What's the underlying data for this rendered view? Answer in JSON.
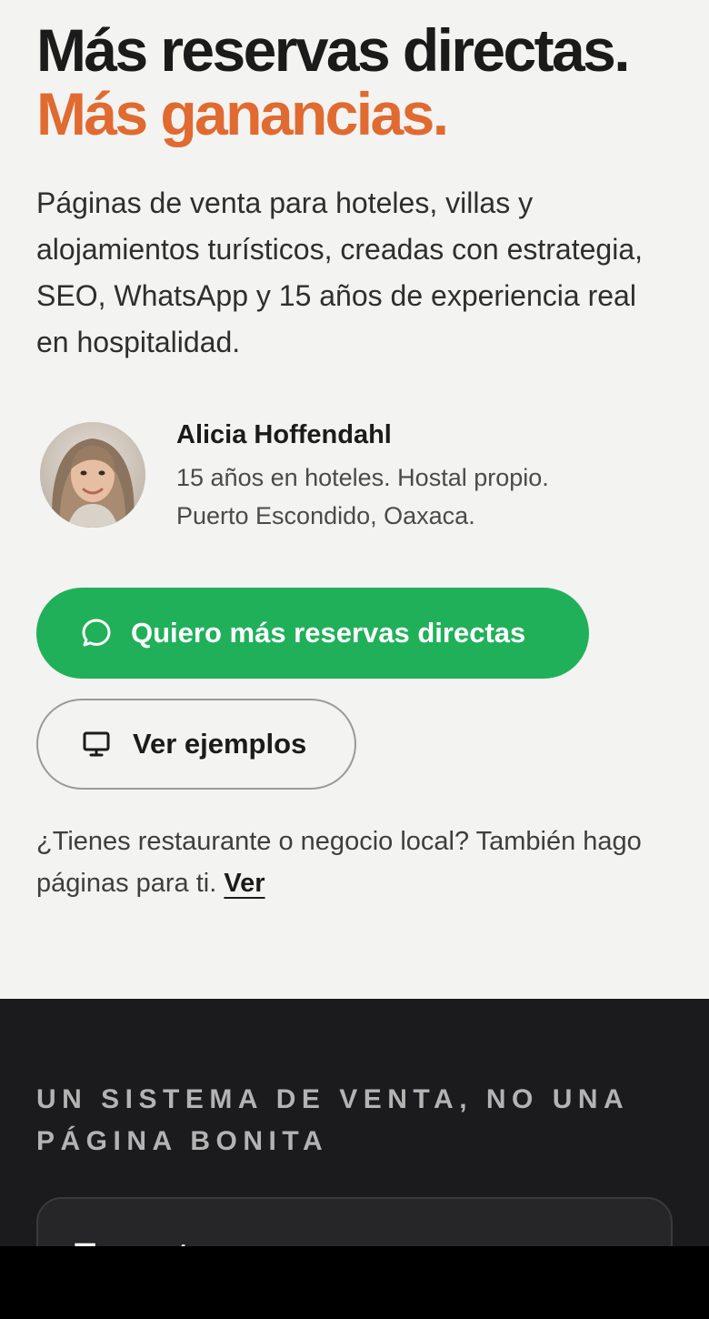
{
  "hero": {
    "headline_line1": "Más reservas directas.",
    "headline_line2": "Más ganancias.",
    "subtitle": "Páginas de venta para hoteles, villas y alojamientos turísticos, creadas con estrategia, SEO, WhatsApp y 15 años de experiencia real en hospitalidad.",
    "author": {
      "name": "Alicia Hoffendahl",
      "bio_line1": "15 años en hoteles. Hostal propio.",
      "bio_line2": "Puerto Escondido, Oaxaca."
    },
    "primary_cta": {
      "label": "Quiero más reservas directas",
      "icon": "whatsapp-chat-icon"
    },
    "secondary_cta": {
      "label": "Ver ejemplos",
      "icon": "monitor-icon"
    },
    "note_text": "¿Tienes restaurante o negocio local? También hago páginas para ti.",
    "note_link": "Ver"
  },
  "dark_section": {
    "eyebrow": "UN SISTEMA DE VENTA, NO UNA PÁGINA BONITA",
    "card_peek": "Tu parte"
  },
  "colors": {
    "background": "#f3f3f1",
    "headline": "#1b1b1b",
    "accent_orange": "#e06a30",
    "cta_green": "#21b05a",
    "dark_section": "#1b1b1d",
    "eyebrow": "#b3b3b3"
  }
}
